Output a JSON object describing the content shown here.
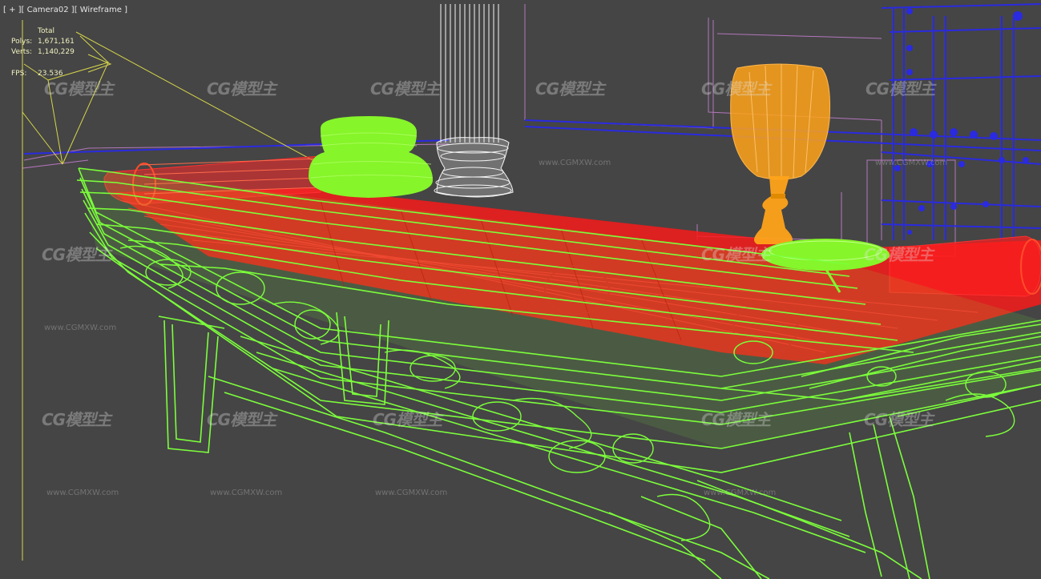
{
  "viewport": {
    "menu_label": "[ + ]",
    "camera_label": "[ Camera02 ]",
    "mode_label": "[ Wireframe ]"
  },
  "stats": {
    "header": "Total",
    "polys_label": "Polys:",
    "polys_value": "1,671,161",
    "verts_label": "Verts:",
    "verts_value": "1,140,229",
    "fps_label": "FPS:",
    "fps_value": "23.536"
  },
  "watermark": {
    "logo_text": "CG模型主",
    "url_text": "www.CGMXW.com"
  },
  "colors": {
    "background": "#454545",
    "bed_frame": "#7cff3c",
    "mattress": "#ff1a1a",
    "pillow_green": "#8cff2a",
    "lamp": "#ffa31a",
    "column": "#ffffff",
    "wall_blue": "#2626d9",
    "wall_pink": "#d07fd9",
    "camera_gizmo": "#d9d94a"
  },
  "scene_objects": [
    "camera-gizmo",
    "white-column",
    "green-pillow",
    "red-bolster",
    "red-mattress",
    "orange-lamp",
    "green-tray",
    "bed-frame",
    "blue-wall-grid"
  ]
}
